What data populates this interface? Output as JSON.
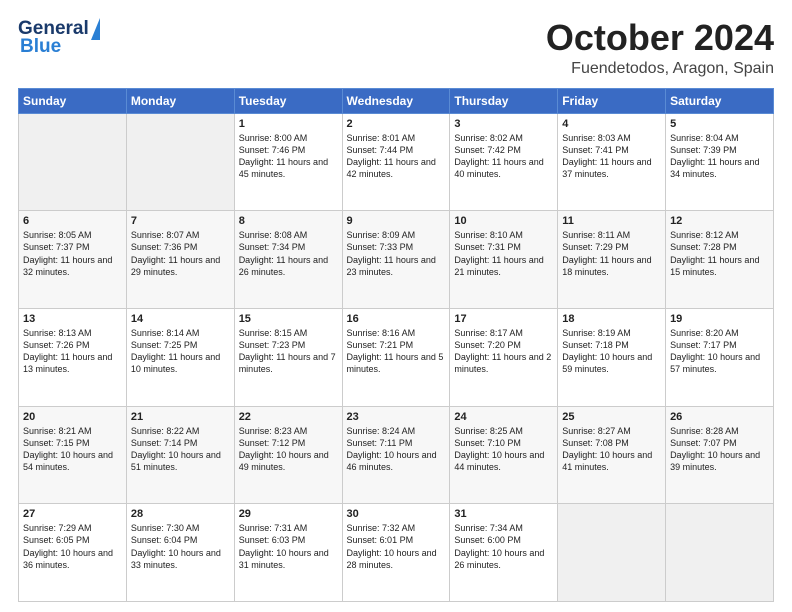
{
  "header": {
    "logo_general": "General",
    "logo_blue": "Blue",
    "month": "October 2024",
    "location": "Fuendetodos, Aragon, Spain"
  },
  "weekdays": [
    "Sunday",
    "Monday",
    "Tuesday",
    "Wednesday",
    "Thursday",
    "Friday",
    "Saturday"
  ],
  "weeks": [
    [
      {
        "day": "",
        "empty": true
      },
      {
        "day": "",
        "empty": true
      },
      {
        "day": "1",
        "sunrise": "Sunrise: 8:00 AM",
        "sunset": "Sunset: 7:46 PM",
        "daylight": "Daylight: 11 hours and 45 minutes."
      },
      {
        "day": "2",
        "sunrise": "Sunrise: 8:01 AM",
        "sunset": "Sunset: 7:44 PM",
        "daylight": "Daylight: 11 hours and 42 minutes."
      },
      {
        "day": "3",
        "sunrise": "Sunrise: 8:02 AM",
        "sunset": "Sunset: 7:42 PM",
        "daylight": "Daylight: 11 hours and 40 minutes."
      },
      {
        "day": "4",
        "sunrise": "Sunrise: 8:03 AM",
        "sunset": "Sunset: 7:41 PM",
        "daylight": "Daylight: 11 hours and 37 minutes."
      },
      {
        "day": "5",
        "sunrise": "Sunrise: 8:04 AM",
        "sunset": "Sunset: 7:39 PM",
        "daylight": "Daylight: 11 hours and 34 minutes."
      }
    ],
    [
      {
        "day": "6",
        "sunrise": "Sunrise: 8:05 AM",
        "sunset": "Sunset: 7:37 PM",
        "daylight": "Daylight: 11 hours and 32 minutes."
      },
      {
        "day": "7",
        "sunrise": "Sunrise: 8:07 AM",
        "sunset": "Sunset: 7:36 PM",
        "daylight": "Daylight: 11 hours and 29 minutes."
      },
      {
        "day": "8",
        "sunrise": "Sunrise: 8:08 AM",
        "sunset": "Sunset: 7:34 PM",
        "daylight": "Daylight: 11 hours and 26 minutes."
      },
      {
        "day": "9",
        "sunrise": "Sunrise: 8:09 AM",
        "sunset": "Sunset: 7:33 PM",
        "daylight": "Daylight: 11 hours and 23 minutes."
      },
      {
        "day": "10",
        "sunrise": "Sunrise: 8:10 AM",
        "sunset": "Sunset: 7:31 PM",
        "daylight": "Daylight: 11 hours and 21 minutes."
      },
      {
        "day": "11",
        "sunrise": "Sunrise: 8:11 AM",
        "sunset": "Sunset: 7:29 PM",
        "daylight": "Daylight: 11 hours and 18 minutes."
      },
      {
        "day": "12",
        "sunrise": "Sunrise: 8:12 AM",
        "sunset": "Sunset: 7:28 PM",
        "daylight": "Daylight: 11 hours and 15 minutes."
      }
    ],
    [
      {
        "day": "13",
        "sunrise": "Sunrise: 8:13 AM",
        "sunset": "Sunset: 7:26 PM",
        "daylight": "Daylight: 11 hours and 13 minutes."
      },
      {
        "day": "14",
        "sunrise": "Sunrise: 8:14 AM",
        "sunset": "Sunset: 7:25 PM",
        "daylight": "Daylight: 11 hours and 10 minutes."
      },
      {
        "day": "15",
        "sunrise": "Sunrise: 8:15 AM",
        "sunset": "Sunset: 7:23 PM",
        "daylight": "Daylight: 11 hours and 7 minutes."
      },
      {
        "day": "16",
        "sunrise": "Sunrise: 8:16 AM",
        "sunset": "Sunset: 7:21 PM",
        "daylight": "Daylight: 11 hours and 5 minutes."
      },
      {
        "day": "17",
        "sunrise": "Sunrise: 8:17 AM",
        "sunset": "Sunset: 7:20 PM",
        "daylight": "Daylight: 11 hours and 2 minutes."
      },
      {
        "day": "18",
        "sunrise": "Sunrise: 8:19 AM",
        "sunset": "Sunset: 7:18 PM",
        "daylight": "Daylight: 10 hours and 59 minutes."
      },
      {
        "day": "19",
        "sunrise": "Sunrise: 8:20 AM",
        "sunset": "Sunset: 7:17 PM",
        "daylight": "Daylight: 10 hours and 57 minutes."
      }
    ],
    [
      {
        "day": "20",
        "sunrise": "Sunrise: 8:21 AM",
        "sunset": "Sunset: 7:15 PM",
        "daylight": "Daylight: 10 hours and 54 minutes."
      },
      {
        "day": "21",
        "sunrise": "Sunrise: 8:22 AM",
        "sunset": "Sunset: 7:14 PM",
        "daylight": "Daylight: 10 hours and 51 minutes."
      },
      {
        "day": "22",
        "sunrise": "Sunrise: 8:23 AM",
        "sunset": "Sunset: 7:12 PM",
        "daylight": "Daylight: 10 hours and 49 minutes."
      },
      {
        "day": "23",
        "sunrise": "Sunrise: 8:24 AM",
        "sunset": "Sunset: 7:11 PM",
        "daylight": "Daylight: 10 hours and 46 minutes."
      },
      {
        "day": "24",
        "sunrise": "Sunrise: 8:25 AM",
        "sunset": "Sunset: 7:10 PM",
        "daylight": "Daylight: 10 hours and 44 minutes."
      },
      {
        "day": "25",
        "sunrise": "Sunrise: 8:27 AM",
        "sunset": "Sunset: 7:08 PM",
        "daylight": "Daylight: 10 hours and 41 minutes."
      },
      {
        "day": "26",
        "sunrise": "Sunrise: 8:28 AM",
        "sunset": "Sunset: 7:07 PM",
        "daylight": "Daylight: 10 hours and 39 minutes."
      }
    ],
    [
      {
        "day": "27",
        "sunrise": "Sunrise: 7:29 AM",
        "sunset": "Sunset: 6:05 PM",
        "daylight": "Daylight: 10 hours and 36 minutes."
      },
      {
        "day": "28",
        "sunrise": "Sunrise: 7:30 AM",
        "sunset": "Sunset: 6:04 PM",
        "daylight": "Daylight: 10 hours and 33 minutes."
      },
      {
        "day": "29",
        "sunrise": "Sunrise: 7:31 AM",
        "sunset": "Sunset: 6:03 PM",
        "daylight": "Daylight: 10 hours and 31 minutes."
      },
      {
        "day": "30",
        "sunrise": "Sunrise: 7:32 AM",
        "sunset": "Sunset: 6:01 PM",
        "daylight": "Daylight: 10 hours and 28 minutes."
      },
      {
        "day": "31",
        "sunrise": "Sunrise: 7:34 AM",
        "sunset": "Sunset: 6:00 PM",
        "daylight": "Daylight: 10 hours and 26 minutes."
      },
      {
        "day": "",
        "empty": true
      },
      {
        "day": "",
        "empty": true
      }
    ]
  ]
}
